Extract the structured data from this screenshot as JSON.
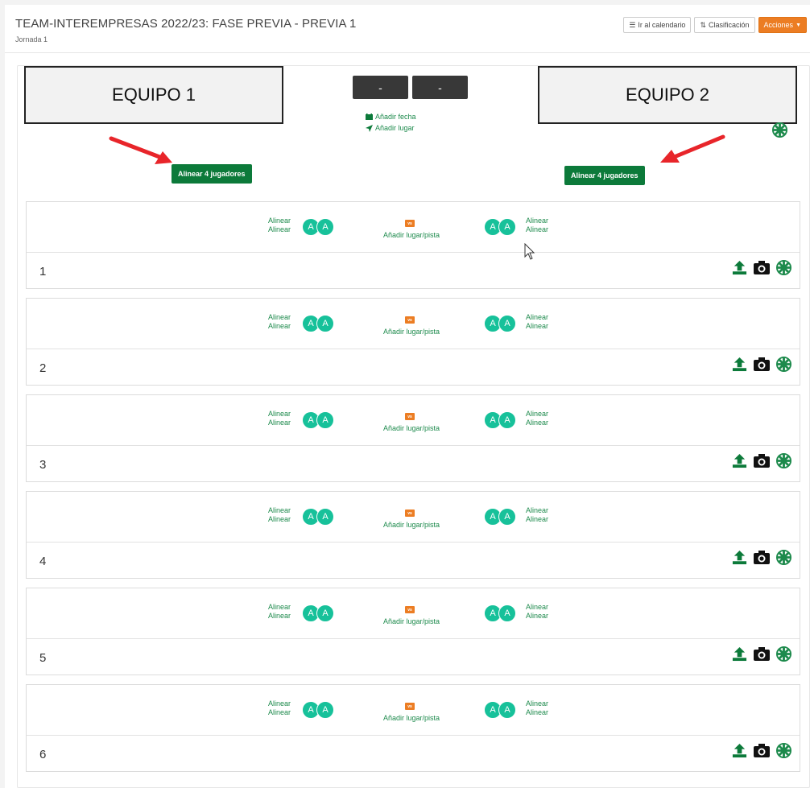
{
  "header": {
    "title": "TEAM-INTEREMPRESAS 2022/23: FASE PREVIA - PREVIA 1",
    "subtitle": "Jornada 1",
    "calendar_btn": "Ir al calendario",
    "standings_btn": "Clasificación",
    "actions_btn": "Acciones"
  },
  "match_header": {
    "team1": "EQUIPO 1",
    "team2": "EQUIPO 2",
    "score1": "-",
    "score2": "-",
    "add_date": "Añadir fecha",
    "add_place": "Añadir lugar",
    "line_up_left": "Alinear 4 jugadores",
    "line_up_right": "Alinear 4 jugadores"
  },
  "matches": [
    {
      "number": "1",
      "align1": "Alinear",
      "align2": "Alinear",
      "avatar": "A",
      "vs": "vs",
      "venue": "Añadir lugar/pista"
    },
    {
      "number": "2",
      "align1": "Alinear",
      "align2": "Alinear",
      "avatar": "A",
      "vs": "vs",
      "venue": "Añadir lugar/pista"
    },
    {
      "number": "3",
      "align1": "Alinear",
      "align2": "Alinear",
      "avatar": "A",
      "vs": "vs",
      "venue": "Añadir lugar/pista"
    },
    {
      "number": "4",
      "align1": "Alinear",
      "align2": "Alinear",
      "avatar": "A",
      "vs": "vs",
      "venue": "Añadir lugar/pista"
    },
    {
      "number": "5",
      "align1": "Alinear",
      "align2": "Alinear",
      "avatar": "A",
      "vs": "vs",
      "venue": "Añadir lugar/pista"
    },
    {
      "number": "6",
      "align1": "Alinear",
      "align2": "Alinear",
      "avatar": "A",
      "vs": "vs",
      "venue": "Añadir lugar/pista"
    }
  ],
  "colors": {
    "green": "#0c7a3a",
    "link_green": "#1d8a4c",
    "orange": "#ec7d23",
    "teal": "#17c19a",
    "red_arrow": "#e8252a"
  },
  "icons": {
    "upload": "upload-icon",
    "camera": "camera-icon",
    "ball": "basketball-icon",
    "calendar": "calendar-icon",
    "location": "location-arrow-icon"
  }
}
